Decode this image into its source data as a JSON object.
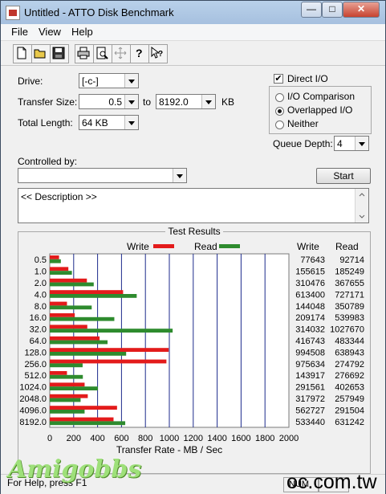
{
  "window": {
    "title": "Untitled - ATTO Disk Benchmark"
  },
  "titlebar_buttons": {
    "minimize": "—",
    "maximize": "□",
    "close": "✕"
  },
  "menu": [
    "File",
    "View",
    "Help"
  ],
  "toolbar": [
    "new-icon",
    "open-icon",
    "save-icon",
    "print-icon",
    "print-preview-icon",
    "move-icon",
    "help-icon",
    "context-help-icon"
  ],
  "form": {
    "drive_label": "Drive:",
    "drive_value": "[-c-]",
    "transfer_size_label": "Transfer Size:",
    "transfer_from": "0.5",
    "to_label": "to",
    "transfer_to": "8192.0",
    "kb_label": "KB",
    "total_length_label": "Total Length:",
    "total_length_value": "64 KB",
    "direct_io_label": "Direct I/O",
    "direct_io_checked": true,
    "io_options": [
      "I/O Comparison",
      "Overlapped I/O",
      "Neither"
    ],
    "io_selected": "Overlapped I/O",
    "queue_depth_label": "Queue Depth:",
    "queue_depth_value": "4",
    "controlled_by_label": "Controlled by:",
    "controlled_by_value": "",
    "start_label": "Start",
    "description_text": "<< Description >>"
  },
  "results": {
    "title": "Test Results",
    "legend_write": "Write",
    "legend_read": "Read",
    "col_write": "Write",
    "col_read": "Read",
    "rows": [
      {
        "size": "0.5",
        "write": "77643",
        "read": "92714"
      },
      {
        "size": "1.0",
        "write": "155615",
        "read": "185249"
      },
      {
        "size": "2.0",
        "write": "310476",
        "read": "367655"
      },
      {
        "size": "4.0",
        "write": "613400",
        "read": "727171"
      },
      {
        "size": "8.0",
        "write": "144048",
        "read": "350789"
      },
      {
        "size": "16.0",
        "write": "209174",
        "read": "539983"
      },
      {
        "size": "32.0",
        "write": "314032",
        "read": "1027670"
      },
      {
        "size": "64.0",
        "write": "416743",
        "read": "483344"
      },
      {
        "size": "128.0",
        "write": "994508",
        "read": "638943"
      },
      {
        "size": "256.0",
        "write": "975634",
        "read": "274792"
      },
      {
        "size": "512.0",
        "write": "143917",
        "read": "276692"
      },
      {
        "size": "1024.0",
        "write": "291561",
        "read": "402653"
      },
      {
        "size": "2048.0",
        "write": "317972",
        "read": "257949"
      },
      {
        "size": "4096.0",
        "write": "562727",
        "read": "291504"
      },
      {
        "size": "8192.0",
        "write": "533440",
        "read": "631242"
      }
    ],
    "x_ticks": [
      "0",
      "200",
      "400",
      "600",
      "800",
      "1000",
      "1200",
      "1400",
      "1600",
      "1800",
      "2000"
    ],
    "x_label": "Transfer Rate - MB / Sec"
  },
  "chart_data": {
    "type": "bar",
    "orientation": "horizontal",
    "title": "Test Results",
    "xlabel": "Transfer Rate - MB / Sec",
    "xlim": [
      0,
      2000
    ],
    "categories": [
      "0.5",
      "1.0",
      "2.0",
      "4.0",
      "8.0",
      "16.0",
      "32.0",
      "64.0",
      "128.0",
      "256.0",
      "512.0",
      "1024.0",
      "2048.0",
      "4096.0",
      "8192.0"
    ],
    "series": [
      {
        "name": "Write",
        "color": "#e31b1b",
        "values": [
          77.6,
          155.6,
          310.5,
          613.4,
          144.0,
          209.2,
          314.0,
          416.7,
          994.5,
          975.6,
          143.9,
          291.6,
          318.0,
          562.7,
          533.4
        ]
      },
      {
        "name": "Read",
        "color": "#2e8b2e",
        "values": [
          92.7,
          185.2,
          367.7,
          727.2,
          350.8,
          540.0,
          1027.7,
          483.3,
          638.9,
          274.8,
          276.7,
          402.7,
          257.9,
          291.5,
          631.2
        ]
      }
    ]
  },
  "status": {
    "help_text": "For Help, press F1",
    "num": "NUM"
  },
  "watermark": {
    "left": "Amigobbs",
    "right": "oc.com.tw"
  }
}
